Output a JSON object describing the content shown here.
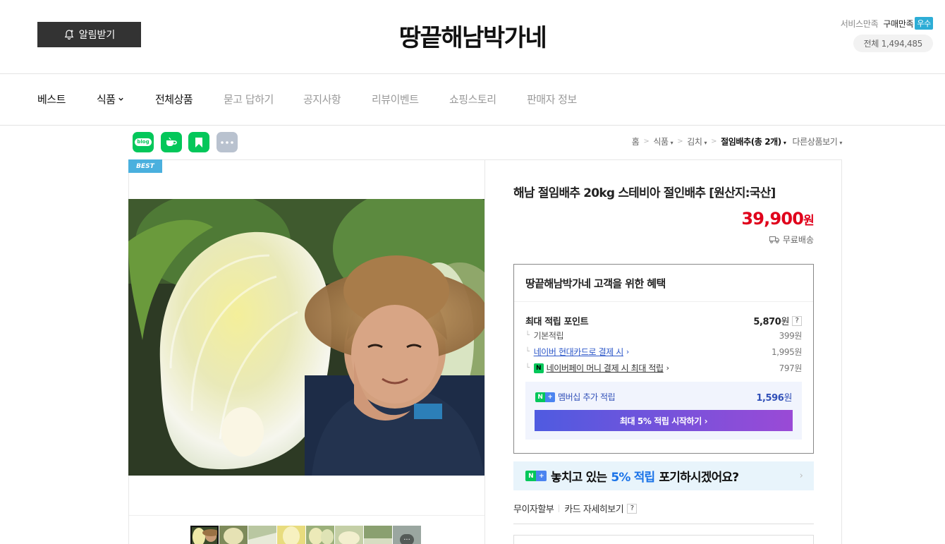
{
  "header": {
    "alarm_label": "알림받기",
    "store_name": "땅끝해남박가네",
    "grade_service": "서비스만족",
    "grade_purchase": "구매만족",
    "grade_badge": "우수",
    "visitors": "전체 1,494,485"
  },
  "nav": {
    "items": [
      {
        "label": "베스트"
      },
      {
        "label": "식품"
      },
      {
        "label": "전체상품"
      },
      {
        "label": "묻고 답하기"
      },
      {
        "label": "공지사항"
      },
      {
        "label": "리뷰이벤트"
      },
      {
        "label": "쇼핑스토리"
      },
      {
        "label": "판매자 정보"
      }
    ]
  },
  "share": {
    "blog_label": "blog"
  },
  "breadcrumb": {
    "home": "홈",
    "cat1": "식품",
    "cat2": "김치",
    "current": "절임배추(총 2개)",
    "other": "다른상품보기"
  },
  "product": {
    "badge": "BEST",
    "name": "해남 절임배추 20kg 스테비아 절인배추 [원산지:국산]",
    "price": "39,900",
    "price_unit": "원",
    "delivery": "무료배송",
    "thumb_more": "···"
  },
  "benefit": {
    "title": "땅끝해남박가네 고객을 위한 혜택",
    "max_point_label": "최대 적립 포인트",
    "max_point_value": "5,870",
    "won": "원",
    "q": "?",
    "basic_label": "기본적립",
    "basic_value": "399원",
    "card_label": "네이버 현대카드로 결제 시",
    "card_value": "1,995원",
    "npay_label": "네이버페이 머니 결제 시 최대 적립",
    "npay_value": "797원",
    "npay_mark": "N",
    "membership_label": "멤버십 추가 적립",
    "membership_value": "1,596",
    "membership_btn": "최대 5% 적립 시작하기 ›"
  },
  "promo": {
    "before": "놓치고 있는",
    "highlight": "5% 적립",
    "after": "포기하시겠어요?",
    "arrow": "›"
  },
  "card": {
    "installment": "무이자할부",
    "detail": "카드 자세히보기",
    "q": "?"
  },
  "colors": {
    "price": "#e0001b",
    "naver_green": "#03c75a",
    "accent_blue": "#1a73e8",
    "badge_blue": "#4ab0de"
  }
}
